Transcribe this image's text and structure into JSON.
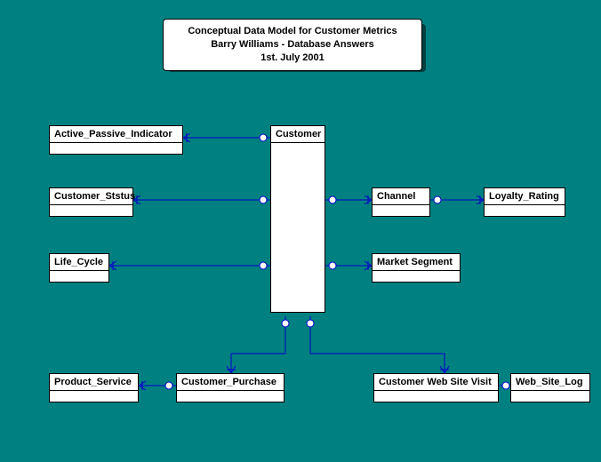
{
  "title": {
    "line1": "Conceptual Data Model for Customer Metrics",
    "line2": "Barry Williams - Database Answers",
    "line3": "1st. July 2001"
  },
  "entities": {
    "active_passive_indicator": "Active_Passive_Indicator",
    "customer_status": "Customer_Ststus",
    "life_cycle": "Life_Cycle",
    "customer": "Customer",
    "channel": "Channel",
    "loyalty_rating": "Loyalty_Rating",
    "market_segment": "Market Segment",
    "product_service": "Product_Service",
    "customer_purchase": "Customer_Purchase",
    "customer_web_site_visit": "Customer Web Site Visit",
    "web_site_log": "Web_Site_Log"
  },
  "relationships": [
    {
      "from": "Customer",
      "to": "Active_Passive_Indicator"
    },
    {
      "from": "Customer",
      "to": "Customer_Ststus"
    },
    {
      "from": "Customer",
      "to": "Life_Cycle"
    },
    {
      "from": "Customer",
      "to": "Channel"
    },
    {
      "from": "Channel",
      "to": "Loyalty_Rating"
    },
    {
      "from": "Customer",
      "to": "Market Segment"
    },
    {
      "from": "Customer",
      "to": "Customer_Purchase"
    },
    {
      "from": "Customer_Purchase",
      "to": "Product_Service"
    },
    {
      "from": "Customer",
      "to": "Customer Web Site Visit"
    },
    {
      "from": "Customer Web Site Visit",
      "to": "Web_Site_Log"
    }
  ]
}
